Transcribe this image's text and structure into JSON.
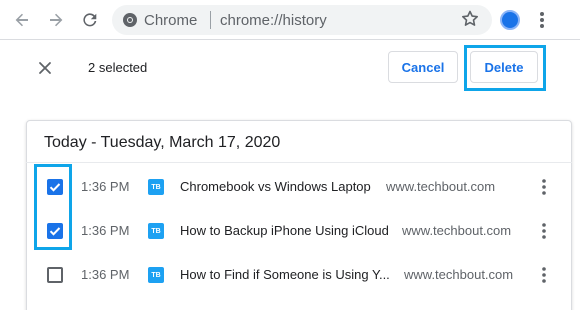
{
  "browser": {
    "site_chip": "Chrome",
    "url": "chrome://history",
    "icons": {
      "back": "back-arrow-icon",
      "forward": "forward-arrow-icon",
      "reload": "reload-icon",
      "site_info": "chrome-logo-icon",
      "bookmark": "star-icon",
      "profile": "profile-avatar-icon",
      "menu": "kebab-menu-icon"
    }
  },
  "selection_bar": {
    "count_text": "2 selected",
    "cancel_label": "Cancel",
    "delete_label": "Delete"
  },
  "history": {
    "day_heading": "Today - Tuesday, March 17, 2020",
    "entries": [
      {
        "checked": true,
        "time": "1:36 PM",
        "favicon": "TB",
        "title": "Chromebook vs Windows Laptop",
        "domain": "www.techbout.com"
      },
      {
        "checked": true,
        "time": "1:36 PM",
        "favicon": "TB",
        "title": "How to Backup iPhone Using iCloud",
        "domain": "www.techbout.com"
      },
      {
        "checked": false,
        "time": "1:36 PM",
        "favicon": "TB",
        "title": "How to Find if Someone is Using Y...",
        "domain": "www.techbout.com"
      }
    ]
  },
  "colors": {
    "accent": "#1a73e8",
    "annotation": "#0ea5e9",
    "favicon": "#1da1f2"
  }
}
